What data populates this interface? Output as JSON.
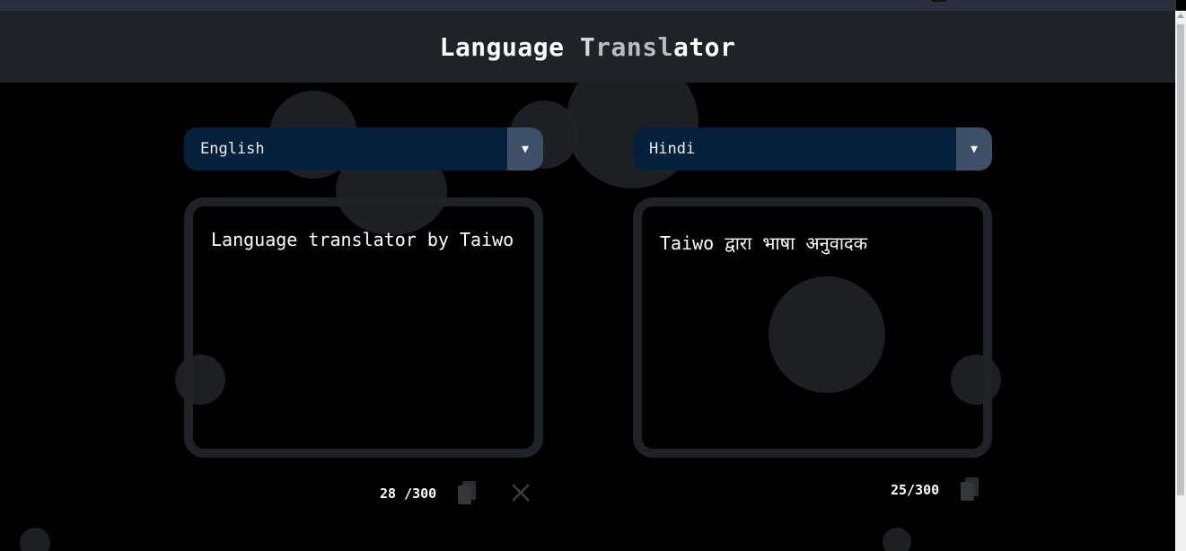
{
  "header": {
    "title_part1": "Language ",
    "title_part2": "T",
    "title_part3": "ransl",
    "title_part4": "ator"
  },
  "source": {
    "language": "English",
    "text": "Language translator by Taiwo",
    "count": "28 /300"
  },
  "target": {
    "language": "Hindi",
    "text": "Taiwo द्वारा भाषा अनुवादक",
    "count": "25/300"
  },
  "icons": {
    "dropdown": "chevron-down-icon",
    "copy": "copy-icon",
    "clear": "close-icon"
  },
  "colors": {
    "header_bg": "#1f2226",
    "select_bg": "#04203a",
    "select_arrow_bg": "#3e5068",
    "box_border": "#1f2226"
  }
}
